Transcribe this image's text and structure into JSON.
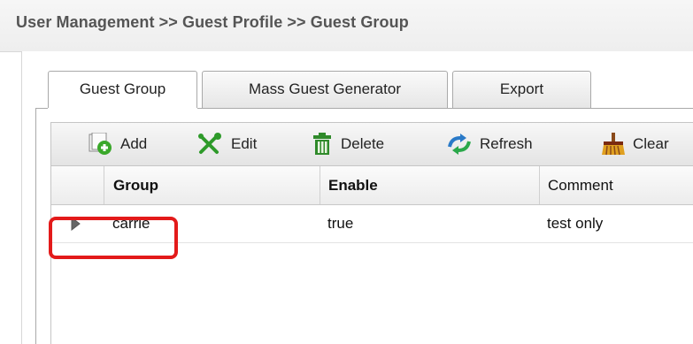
{
  "header": {
    "breadcrumb": "User Management >> Guest Profile >> Guest Group"
  },
  "tabs": [
    {
      "label": "Guest Group",
      "active": true
    },
    {
      "label": "Mass Guest Generator",
      "active": false
    },
    {
      "label": "Export",
      "active": false
    }
  ],
  "toolbar": {
    "add_label": "Add",
    "edit_label": "Edit",
    "delete_label": "Delete",
    "refresh_label": "Refresh",
    "clear_label": "Clear"
  },
  "table": {
    "columns": [
      "Group",
      "Enable",
      "Comment"
    ],
    "rows": [
      {
        "group": "carrie",
        "enable": "true",
        "comment": "test only",
        "highlighted": true
      }
    ]
  },
  "colors": {
    "highlight": "#e31a1a",
    "add_icon": "#3aa82a",
    "edit_icon": "#2e9a2a",
    "delete_icon": "#2f8a2a",
    "refresh_icon": "#2a7ac8",
    "clear_icon": "#8a4a1a"
  },
  "icons": {
    "add": "add-icon",
    "edit": "edit-tools-icon",
    "delete": "trash-icon",
    "refresh": "refresh-icon",
    "clear": "broom-icon",
    "row_expand": "triangle-right-icon"
  }
}
